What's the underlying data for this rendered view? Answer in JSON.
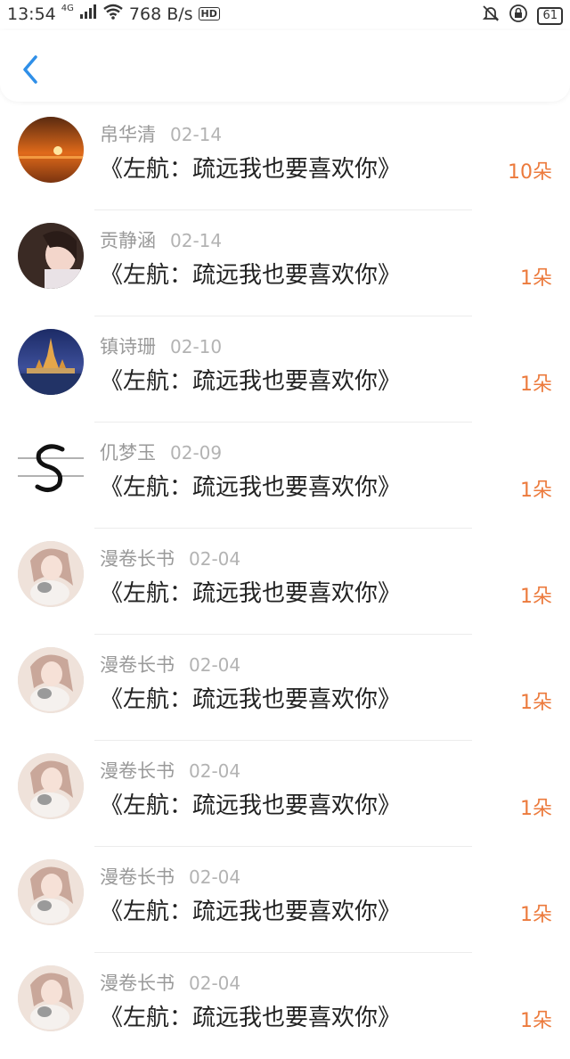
{
  "status_bar": {
    "time": "13:54",
    "network": "4G",
    "speed": "768 B/s",
    "hd": "HD",
    "battery": "61"
  },
  "header": {
    "back_icon": "chevron-left-icon"
  },
  "colors": {
    "accent": "#2f8fe8",
    "count": "#ec7a3c",
    "name": "#9a9a9a",
    "date": "#b3b3b3"
  },
  "records": [
    {
      "name": "帛华清",
      "date": "02-14",
      "title": "《左航：疏远我也要喜欢你》",
      "count": "10朵",
      "avatar": "sunset"
    },
    {
      "name": "贡静涵",
      "date": "02-14",
      "title": "《左航：疏远我也要喜欢你》",
      "count": "1朵",
      "avatar": "girl"
    },
    {
      "name": "镇诗珊",
      "date": "02-10",
      "title": "《左航：疏远我也要喜欢你》",
      "count": "1朵",
      "avatar": "temple"
    },
    {
      "name": "仉梦玉",
      "date": "02-09",
      "title": "《左航：疏远我也要喜欢你》",
      "count": "1朵",
      "avatar": "letter-s"
    },
    {
      "name": "漫卷长书",
      "date": "02-04",
      "title": "《左航：疏远我也要喜欢你》",
      "count": "1朵",
      "avatar": "girl-cat"
    },
    {
      "name": "漫卷长书",
      "date": "02-04",
      "title": "《左航：疏远我也要喜欢你》",
      "count": "1朵",
      "avatar": "girl-cat"
    },
    {
      "name": "漫卷长书",
      "date": "02-04",
      "title": "《左航：疏远我也要喜欢你》",
      "count": "1朵",
      "avatar": "girl-cat"
    },
    {
      "name": "漫卷长书",
      "date": "02-04",
      "title": "《左航：疏远我也要喜欢你》",
      "count": "1朵",
      "avatar": "girl-cat"
    },
    {
      "name": "漫卷长书",
      "date": "02-04",
      "title": "《左航：疏远我也要喜欢你》",
      "count": "1朵",
      "avatar": "girl-cat"
    }
  ]
}
